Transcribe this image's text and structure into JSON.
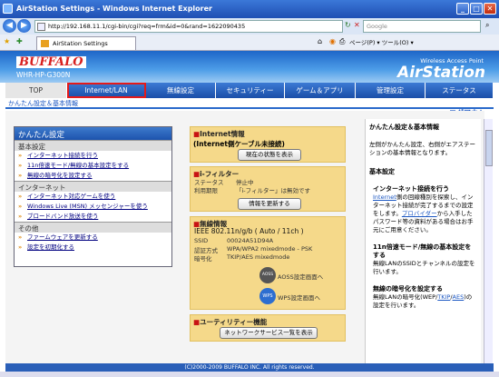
{
  "window": {
    "title": "AirStation Settings - Windows Internet Explorer"
  },
  "browser": {
    "url": "http://192.168.11.1/cgi-bin/cgi?req=frm&id=0&rand=1622090435",
    "search_placeholder": "Google",
    "tab_title": "AirStation Settings",
    "tools": "ページ(P) ▾  ツール(O) ▾"
  },
  "header": {
    "brand": "BUFFALO",
    "model": "WHR-HP-G300N",
    "tagline": "Wireless Access Point",
    "product": "AirStation"
  },
  "menu": {
    "items": [
      "TOP",
      "Internet/LAN",
      "無線設定",
      "セキュリティー",
      "ゲーム＆アプリ",
      "管理設定",
      "ステータス"
    ],
    "active": "Internet/LAN",
    "sub_label": "かんたん設定＆基本情報",
    "logout": "ログアウト"
  },
  "left_nav": {
    "title": "かんたん設定",
    "sections": [
      {
        "heading": "基本設定",
        "links": [
          "インターネット接続を行う",
          "11n倍速モード/無線の基本設定をする",
          "無線の暗号化を設定する"
        ]
      },
      {
        "heading": "インターネット",
        "links": [
          "インターネット対応ゲームを使う",
          "Windows Live (MSN) メッセンジャーを使う",
          "ブロードバンド放送を使う"
        ]
      },
      {
        "heading": "その他",
        "links": [
          "ファームウェアを更新する",
          "設定を初期化する"
        ]
      }
    ]
  },
  "internet_box": {
    "title": "Internet情報",
    "subtitle": "(Internet側ケーブル未接続)",
    "button": "現在の状態を表示"
  },
  "filter_box": {
    "title": "i-フィルター",
    "status_label": "ステータス",
    "status_value": "停止中",
    "period_label": "利用期限",
    "period_value": "「i-フィルター」は無効です",
    "button": "情報を更新する"
  },
  "wireless_box": {
    "title": "無線情報",
    "mode": "IEEE 802.11n/g/b ( Auto / 11ch )",
    "ssid_label": "SSID",
    "ssid_value": "00024A51D94A",
    "auth_label": "認証方式",
    "auth_value": "WPA/WPA2 mixedmode - PSK",
    "enc_label": "暗号化",
    "enc_value": "TKIP/AES mixedmode",
    "aoss_link": "AOSS設定画面へ",
    "wps_link": "WPS設定画面へ",
    "aoss_icon_text": "AOSS",
    "wps_icon_text": "WPS"
  },
  "utility_box": {
    "title": "ユーティリティー機能",
    "button": "ネットワークサービス一覧を表示"
  },
  "help_panel": {
    "heading": "かんたん設定＆基本情報",
    "intro": "左側がかんたん設定、右側がエアステーションの基本情報となります。",
    "section": "基本設定",
    "h1": "インターネット接続を行う",
    "p1a": "Internet",
    "p1b": "側の回線種別を探索し、インターネット接続が完了するまでの設定をします。",
    "p1c": "プロバイダー",
    "p1d": "から入手したパスワード等の資料がある場合はお手元にご用意ください。",
    "h2": "11n倍速モード/無線の基本設定をする",
    "p2": "無線LANのSSIDとチャンネルの設定を行います。",
    "h3": "無線の暗号化を設定する",
    "p3a": "無線LANの暗号化(WEP/",
    "p3b": "TKIP",
    "p3c": "/",
    "p3d": "AES",
    "p3e": ")の設定を行います。"
  },
  "footer": {
    "copyright": "(C)2000-2009 BUFFALO INC. All rights reserved."
  },
  "colors": {
    "accent": "#1a56c2",
    "highlight": "#e41a1a",
    "box": "#f5d98a"
  }
}
